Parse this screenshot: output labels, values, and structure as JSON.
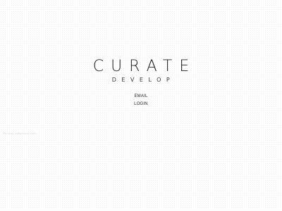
{
  "logo": {
    "primary": "CURATE",
    "secondary": "DEVELOP"
  },
  "nav": {
    "email_label": "EMAIL",
    "login_label": "LOGIN"
  },
  "footnote": {
    "text": "The essay, independent studio"
  },
  "colors": {
    "background": "#ffffff",
    "text": "#222222",
    "faint_text": "#d8d8d8"
  }
}
